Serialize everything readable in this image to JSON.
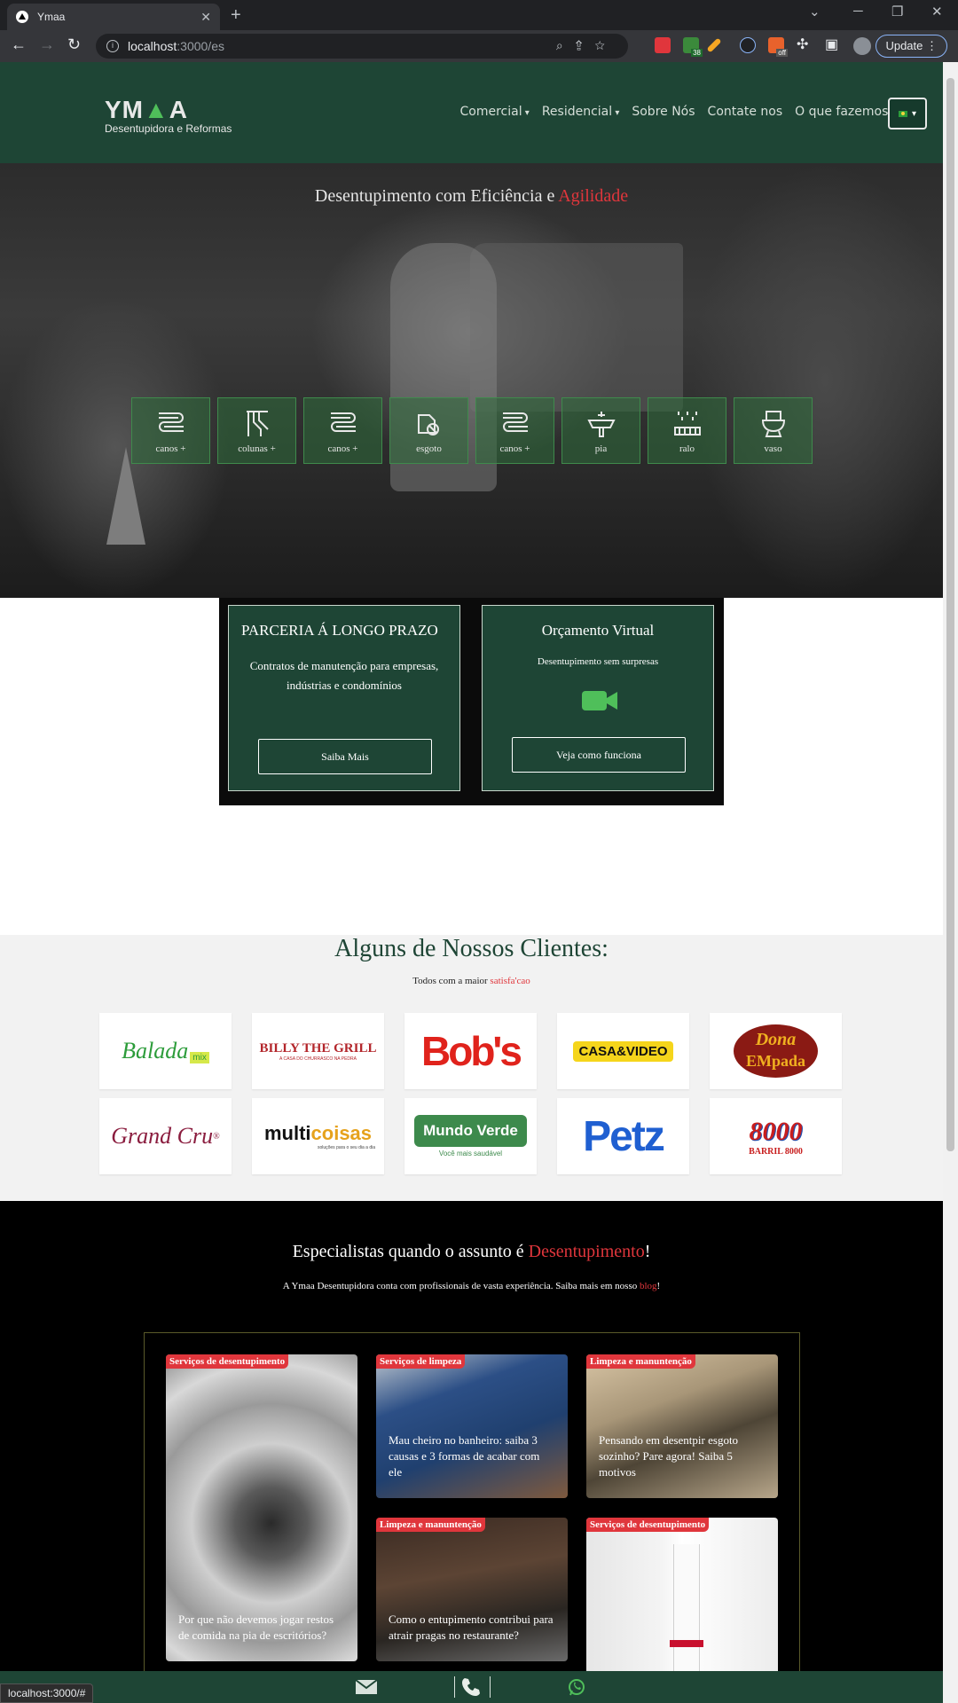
{
  "browser": {
    "tab_title": "Ymaa",
    "tab_close": "✕",
    "new_tab": "+",
    "url_host": "localhost",
    "url_path": ":3000/es",
    "update_label": "Update",
    "ext_badge": "38",
    "ext_badge_off": "off"
  },
  "nav": {
    "logo_main_left": "YM",
    "logo_main_right": "A",
    "logo_sub": "Desentupidora e Reformas",
    "items": [
      "Comercial",
      "Residencial",
      "Sobre Nós",
      "Contate nos",
      "O que fazemos!"
    ]
  },
  "hero": {
    "title": "Desentupimento com Eficiência e ",
    "title_accent": "Agilidade",
    "categories": [
      {
        "label": "canos +",
        "icon": "pipes-icon"
      },
      {
        "label": "colunas +",
        "icon": "column-pipe-icon"
      },
      {
        "label": "canos +",
        "icon": "pipes-icon"
      },
      {
        "label": "esgoto",
        "icon": "sewer-icon"
      },
      {
        "label": "canos +",
        "icon": "pipes-icon"
      },
      {
        "label": "pia",
        "icon": "sink-icon"
      },
      {
        "label": "ralo",
        "icon": "drain-icon"
      },
      {
        "label": "vaso",
        "icon": "toilet-icon"
      }
    ]
  },
  "cards": {
    "card1": {
      "title": "PARCERIA Á LONGO PRAZO",
      "text": "Contratos de manutenção para empresas, indústrias e condomínios",
      "button": "Saiba Mais"
    },
    "card2": {
      "title": "Orçamento Virtual",
      "text": "Desentupimento sem surpresas",
      "button": "Veja como funciona"
    }
  },
  "clients": {
    "title": "Alguns de Nossos Clientes:",
    "subtitle": "Todos com a maior ",
    "subtitle_accent": "satisfa'cao",
    "logos": {
      "balada": "Balada",
      "balada_mix": "mix",
      "billy": "BILLY THE GRILL",
      "billy_sub": "A CASA DO CHURRASCO NA PEDRA",
      "bobs": "Bob's",
      "casavideo": "CASA&VIDEO",
      "dona": "Dona",
      "empada": "EMpada",
      "grandcru": "Grand Cru",
      "multi": "multi",
      "coisas": "coisas",
      "multi_sub": "soluções para o seu dia a dia",
      "mundoverde": "Mundo Verde",
      "mundoverde_sub": "Você mais saudável",
      "petz": "Petz",
      "barril_num": "8000",
      "barril": "BARRIL 8000"
    }
  },
  "specialists": {
    "title": "Especialistas quando o assunto é ",
    "title_accent": "Desentupimento",
    "title_end": "!",
    "subtitle": "A Ymaa Desentupidora conta com profissionais de vasta experiência. Saiba mais em nosso ",
    "subtitle_link": "blog",
    "subtitle_end": "!",
    "posts": [
      {
        "tag": "Serviços de desentupimento",
        "title": "Por que não devemos jogar restos de comida na pia de escritórios?"
      },
      {
        "tag": "Serviços de limpeza",
        "title": "Mau cheiro no banheiro: saiba 3 causas e 3 formas de acabar com ele"
      },
      {
        "tag": "Limpeza e manuntenção",
        "title": "Pensando em desentpir esgoto sozinho? Pare agora! Saiba 5 motivos"
      },
      {
        "tag": "Limpeza e manuntenção",
        "title": "Como o entupimento contribui para atrair pragas no restaurante?"
      },
      {
        "tag": "Serviços de desentupimento",
        "title": ""
      }
    ]
  },
  "status_url": "localhost:3000/#"
}
